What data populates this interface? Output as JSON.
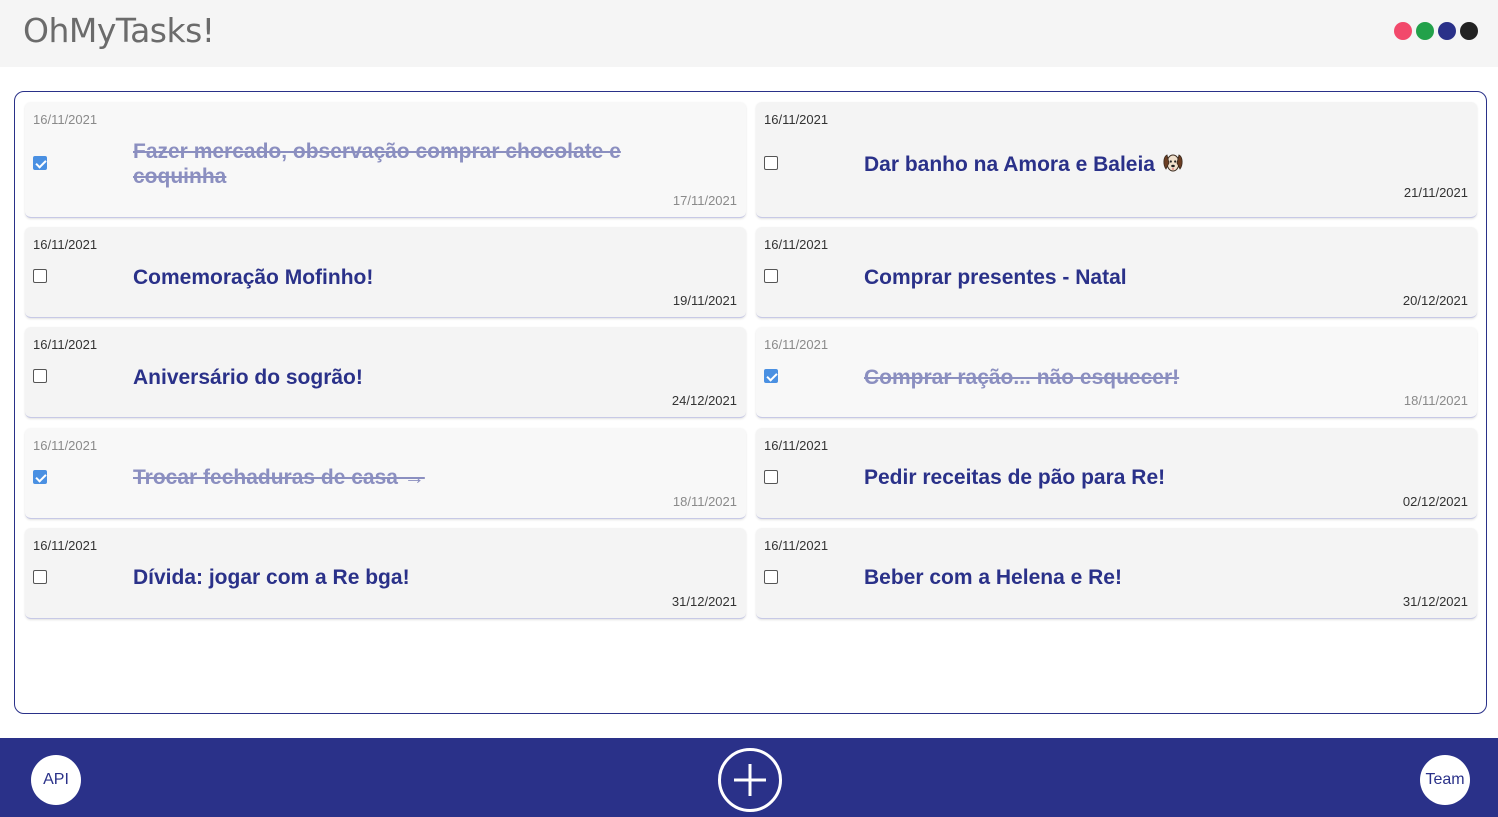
{
  "app": {
    "title": "OhMyTasks!"
  },
  "themes": [
    {
      "name": "red-theme",
      "color": "#f2496b"
    },
    {
      "name": "green-theme",
      "color": "#22a14a"
    },
    {
      "name": "blue-theme",
      "color": "#2a3189"
    },
    {
      "name": "black-theme",
      "color": "#222222"
    }
  ],
  "tasks": [
    {
      "created": "16/11/2021",
      "title": "Fazer mercado, observação comprar chocolate e",
      "title2": "coquinha",
      "due": "17/11/2021",
      "done": true
    },
    {
      "created": "16/11/2021",
      "title": "Dar banho na Amora e Baleia",
      "emoji": "dog-face-icon",
      "due": "21/11/2021",
      "done": false
    },
    {
      "created": "16/11/2021",
      "title": "Comemoração Mofinho!",
      "due": "19/11/2021",
      "done": false
    },
    {
      "created": "16/11/2021",
      "title": "Comprar presentes - Natal",
      "due": "20/12/2021",
      "done": false
    },
    {
      "created": "16/11/2021",
      "title": "Aniversário do sogrão!",
      "due": "24/12/2021",
      "done": false
    },
    {
      "created": "16/11/2021",
      "title": "Comprar ração... não esquecer!",
      "due": "18/11/2021",
      "done": true
    },
    {
      "created": "16/11/2021",
      "title": "Trocar fechaduras de casa →",
      "due": "18/11/2021",
      "done": true
    },
    {
      "created": "16/11/2021",
      "title": "Pedir receitas de pão para Re!",
      "due": "02/12/2021",
      "done": false
    },
    {
      "created": "16/11/2021",
      "title": "Dívida: jogar com a Re bga!",
      "due": "31/12/2021",
      "done": false
    },
    {
      "created": "16/11/2021",
      "title": "Beber com a Helena e Re!",
      "due": "31/12/2021",
      "done": false
    }
  ],
  "footer": {
    "api_label": "API",
    "team_label": "Team",
    "add_icon": "plus-circle-icon"
  }
}
